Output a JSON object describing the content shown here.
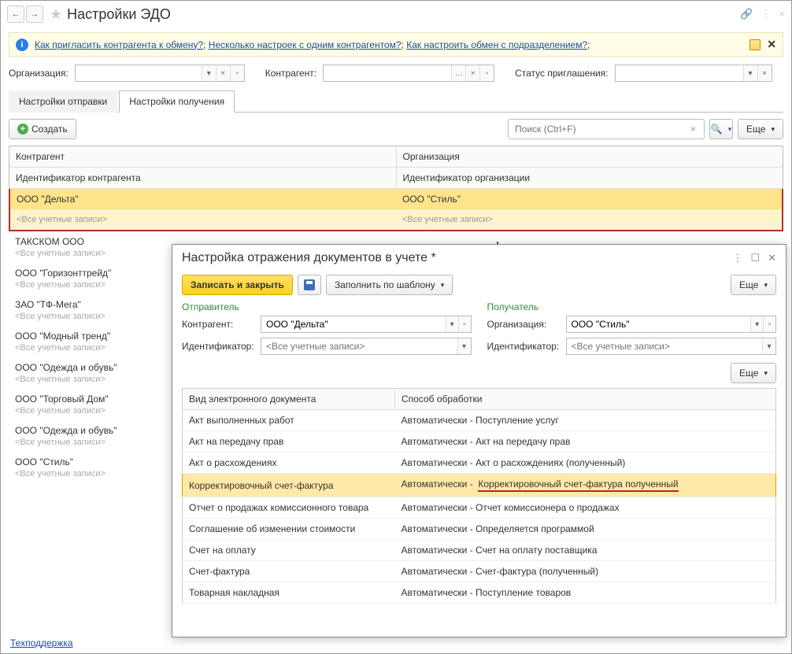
{
  "title": "Настройки ЭДО",
  "info_links": [
    "Как пригласить контрагента к обмену?",
    "Несколько настроек с одним контрагентом?",
    "Как настроить обмен с подразделением?"
  ],
  "filters": {
    "org_label": "Организация:",
    "counterparty_label": "Контрагент:",
    "status_label": "Статус приглашения:"
  },
  "tabs": {
    "send": "Настройки отправки",
    "receive": "Настройки получения"
  },
  "toolbar": {
    "create": "Создать",
    "search_placeholder": "Поиск (Ctrl+F)",
    "more": "Еще"
  },
  "grid_headers": {
    "counterparty": "Контрагент",
    "organization": "Организация",
    "counterparty_id": "Идентификатор контрагента",
    "organization_id": "Идентификатор организации"
  },
  "all_accounts": "<Все учетные записи>",
  "highlighted_row": {
    "counterparty": "ООО \"Дельта\"",
    "organization": "ООО \"Стиль\""
  },
  "left_items": [
    "ТАКСКОМ ООО",
    "ООО \"Горизонттрейд\"",
    "ЗАО \"ТФ-Мега\"",
    "ООО \"Модный тренд\"",
    "ООО \"Одежда и обувь\"",
    "ООО \"Торговый Дом\"",
    "ООО \"Одежда и обувь\"",
    "ООО \"Стиль\""
  ],
  "dialog": {
    "title": "Настройка отражения документов в учете *",
    "save_close": "Записать и закрыть",
    "fill_template": "Заполнить по шаблону",
    "more": "Еще",
    "sender": "Отправитель",
    "receiver": "Получатель",
    "counterparty_label": "Контрагент:",
    "organization_label": "Организация:",
    "identifier_label": "Идентификатор:",
    "counterparty_value": "ООО \"Дельта\"",
    "organization_value": "ООО \"Стиль\"",
    "identifier_placeholder": "<Все учетные записи>",
    "table_headers": {
      "doctype": "Вид электронного документа",
      "method": "Способ обработки"
    },
    "auto": "Автоматически -",
    "rows": [
      {
        "t": "Акт выполненных работ",
        "r": "Поступление услуг"
      },
      {
        "t": "Акт на передачу прав",
        "r": "Акт на передачу прав"
      },
      {
        "t": "Акт о расхождениях",
        "r": "Акт о расхождениях (полученный)"
      },
      {
        "t": "Корректировочный счет-фактура",
        "r": "Корректировочный счет-фактура полученный",
        "hl": true
      },
      {
        "t": "Отчет о продажах комиссионного товара",
        "r": "Отчет комиссионера о продажах"
      },
      {
        "t": "Соглашение об изменении стоимости",
        "r": "Определяется программой"
      },
      {
        "t": "Счет на оплату",
        "r": "Счет на оплату поставщика"
      },
      {
        "t": "Счет-фактура",
        "r": "Счет-фактура (полученный)"
      },
      {
        "t": "Товарная накладная",
        "r": "Поступление товаров"
      }
    ]
  },
  "footer": "Техподдержка"
}
